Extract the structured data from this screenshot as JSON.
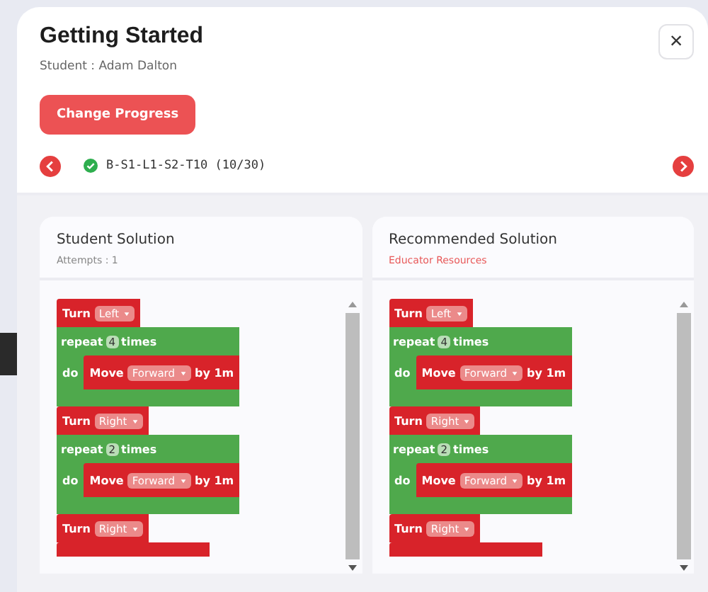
{
  "dialog": {
    "title": "Getting Started",
    "student": "Student : Adam Dalton",
    "close_label": "×",
    "action": "Change Progress"
  },
  "navigator": {
    "task": "B-S1-L1-S2-T10 (10/30)",
    "completed": true
  },
  "panels": [
    {
      "title": "Student Solution",
      "subtitle": {
        "kind": "info",
        "text": "Attempts : 1"
      },
      "blocks": [
        {
          "kind": "turn",
          "label": "Turn",
          "value": "Left"
        },
        {
          "kind": "repeat",
          "label": "repeat",
          "count": "4",
          "suffix": "times",
          "do_label": "do",
          "children": [
            {
              "kind": "move",
              "label": "Move",
              "value": "Forward",
              "suffix": "by 1m"
            }
          ]
        },
        {
          "kind": "turn",
          "label": "Turn",
          "value": "Right"
        },
        {
          "kind": "repeat",
          "label": "repeat",
          "count": "2",
          "suffix": "times",
          "do_label": "do",
          "children": [
            {
              "kind": "move",
              "label": "Move",
              "value": "Forward",
              "suffix": "by 1m"
            }
          ]
        },
        {
          "kind": "turn",
          "label": "Turn",
          "value": "Right"
        },
        {
          "kind": "cut"
        }
      ]
    },
    {
      "title": "Recommended Solution",
      "subtitle": {
        "kind": "link",
        "text": "Educator Resources"
      },
      "blocks": [
        {
          "kind": "turn",
          "label": "Turn",
          "value": "Left"
        },
        {
          "kind": "repeat",
          "label": "repeat",
          "count": "4",
          "suffix": "times",
          "do_label": "do",
          "children": [
            {
              "kind": "move",
              "label": "Move",
              "value": "Forward",
              "suffix": "by 1m"
            }
          ]
        },
        {
          "kind": "turn",
          "label": "Turn",
          "value": "Right"
        },
        {
          "kind": "repeat",
          "label": "repeat",
          "count": "2",
          "suffix": "times",
          "do_label": "do",
          "children": [
            {
              "kind": "move",
              "label": "Move",
              "value": "Forward",
              "suffix": "by 1m"
            }
          ]
        },
        {
          "kind": "turn",
          "label": "Turn",
          "value": "Right"
        },
        {
          "kind": "cut"
        }
      ]
    }
  ]
}
